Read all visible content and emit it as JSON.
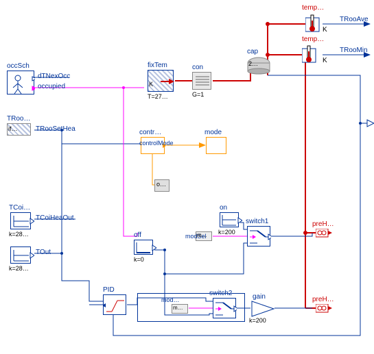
{
  "blocks": {
    "tempAve": {
      "label": "temp…",
      "out": "TRooAve",
      "unit": "K"
    },
    "tempMin": {
      "label": "temp…",
      "out": "TRooMin",
      "unit": "K"
    },
    "cap": {
      "label": "cap",
      "sub": "2…"
    },
    "fixTem": {
      "label": "fixTem",
      "sub": "K",
      "param": "T=27…"
    },
    "con": {
      "label": "con",
      "param": "G=1"
    },
    "occSch": {
      "label": "occSch",
      "out1": "dTNexOcc",
      "out2": "occupied"
    },
    "TRoo": {
      "label": "TRoo…",
      "sub": "if…",
      "out": "TRooSetHea"
    },
    "contr": {
      "label": "contr…",
      "out": "controlMode"
    },
    "mode": {
      "label": "mode"
    },
    "o": {
      "label": "o…"
    },
    "TCoi": {
      "label": "TCoi…",
      "param": "k=28…",
      "out": "TCoiHeaOut"
    },
    "TOut": {
      "label": "TOut",
      "param": "k=28…"
    },
    "on": {
      "label": "on",
      "param": "k=200"
    },
    "modSel": {
      "label": "modSel",
      "sub": "m…"
    },
    "switch1": {
      "label": "switch1"
    },
    "preH1": {
      "label": "preH…"
    },
    "off": {
      "label": "off",
      "param": "k=0"
    },
    "PID": {
      "label": "PID"
    },
    "mod2": {
      "label": "mod…",
      "sub": "m…"
    },
    "switch2": {
      "label": "switch2"
    },
    "gain": {
      "label": "gain",
      "param": "k=200"
    },
    "preH2": {
      "label": "preH…"
    }
  }
}
